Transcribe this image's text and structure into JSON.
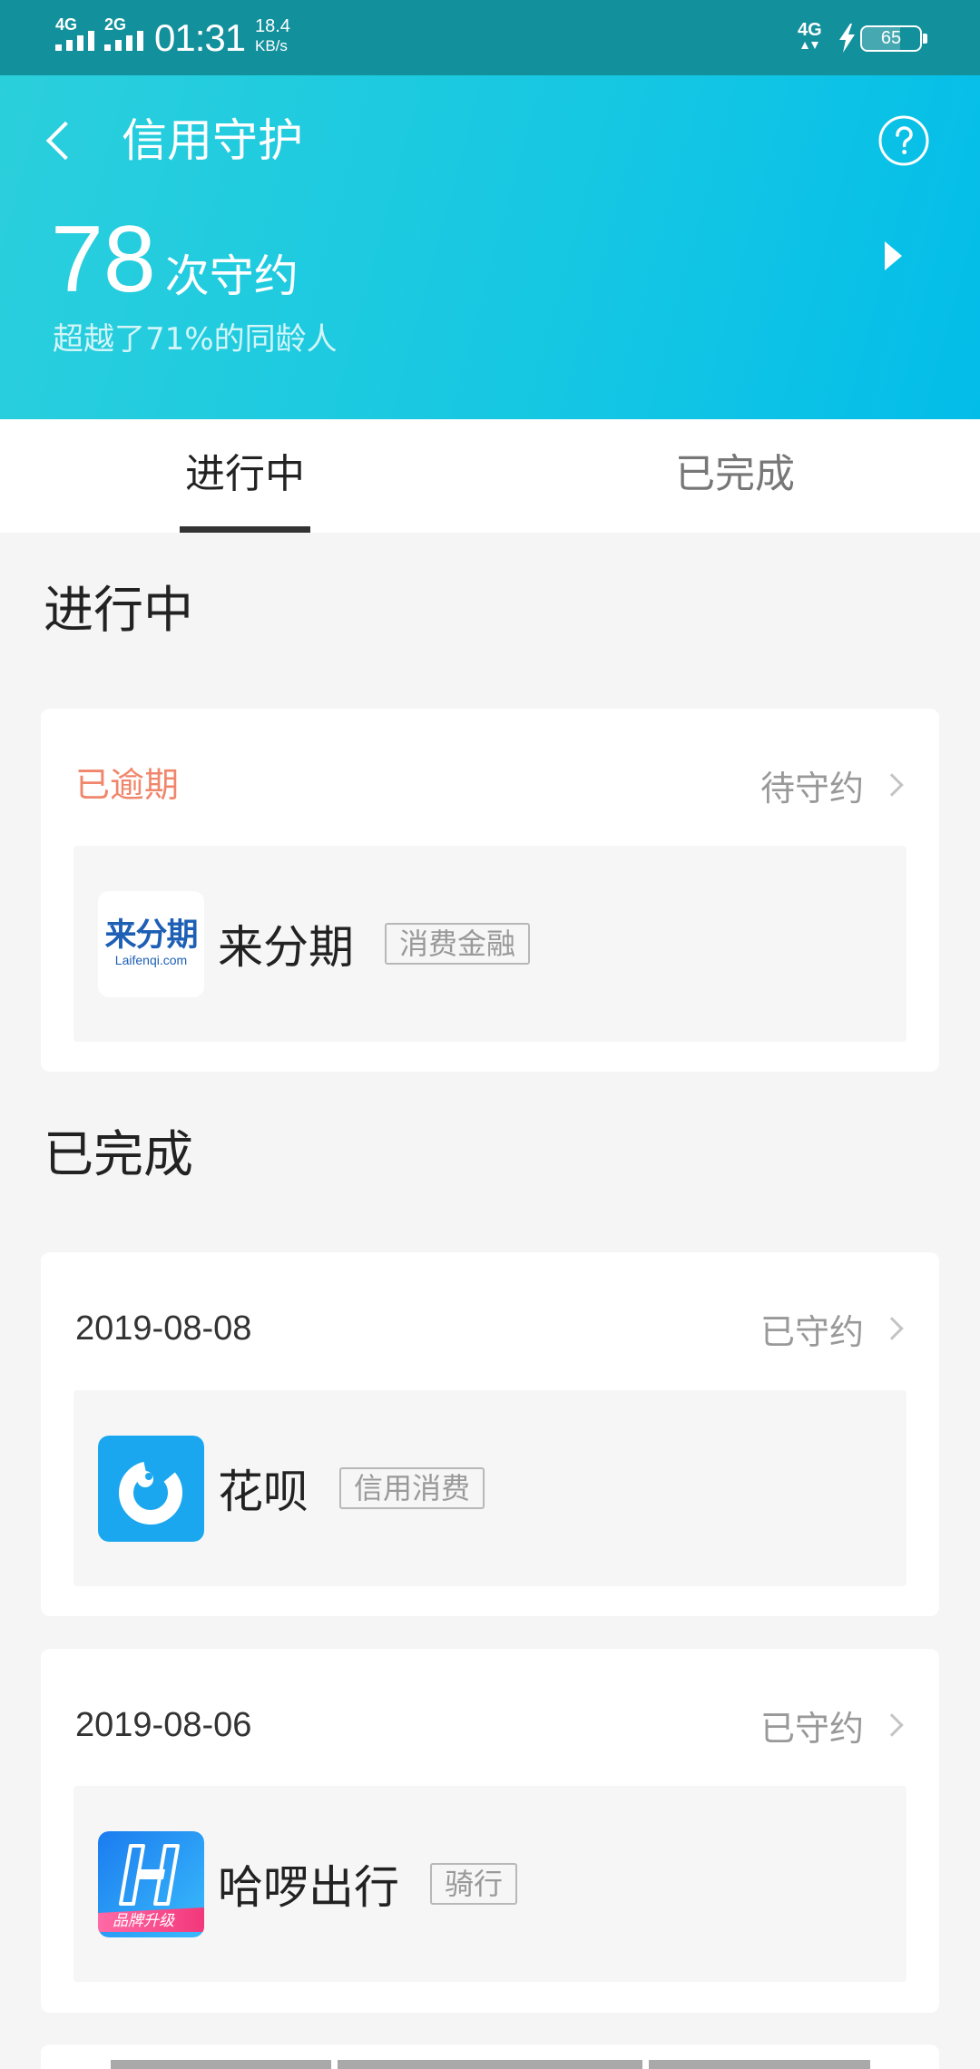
{
  "status_bar": {
    "sim1_network": "4G",
    "sim2_network": "2G",
    "time": "01:31",
    "net_speed": "18.4",
    "net_speed_unit": "KB/s",
    "data_network": "4G",
    "battery_level": "65",
    "icons": [
      "signal-icon",
      "signal-icon",
      "data-activity-icon",
      "charging-icon",
      "battery-icon"
    ]
  },
  "header": {
    "title": "信用守护",
    "kept_count": "78",
    "kept_count_label": "次守约",
    "rank_text": "超越了71%的同龄人",
    "icons": {
      "back": "back-arrow-icon",
      "help": "help-icon",
      "detail": "play-arrow-icon"
    }
  },
  "tabs": [
    {
      "label": "进行中",
      "active": true
    },
    {
      "label": "已完成",
      "active": false
    }
  ],
  "in_progress": {
    "title": "进行中",
    "items": [
      {
        "flag": "已逾期",
        "status": "待守约",
        "app": "来分期",
        "category": "消费金融",
        "logo": {
          "text": "来分期",
          "subtext": "Laifenqi.com"
        }
      }
    ]
  },
  "completed": {
    "title": "已完成",
    "items": [
      {
        "date": "2019-08-08",
        "status": "已守约",
        "app": "花呗",
        "category": "信用消费"
      },
      {
        "date": "2019-08-06",
        "status": "已守约",
        "app": "哈啰出行",
        "category": "骑行",
        "logo": {
          "badge": "品牌升级"
        }
      }
    ]
  },
  "colors": {
    "status_bar_bg": "#12909c",
    "header_gradient_start": "#2bcfdc",
    "header_gradient_end": "#03bde9",
    "overdue_text": "#f0866b",
    "page_bg": "#f5f5f5",
    "huabei_blue": "#1ba7ef",
    "hellobike_blue": "#1f8ff5",
    "hellobike_badge": "#f6488c"
  }
}
